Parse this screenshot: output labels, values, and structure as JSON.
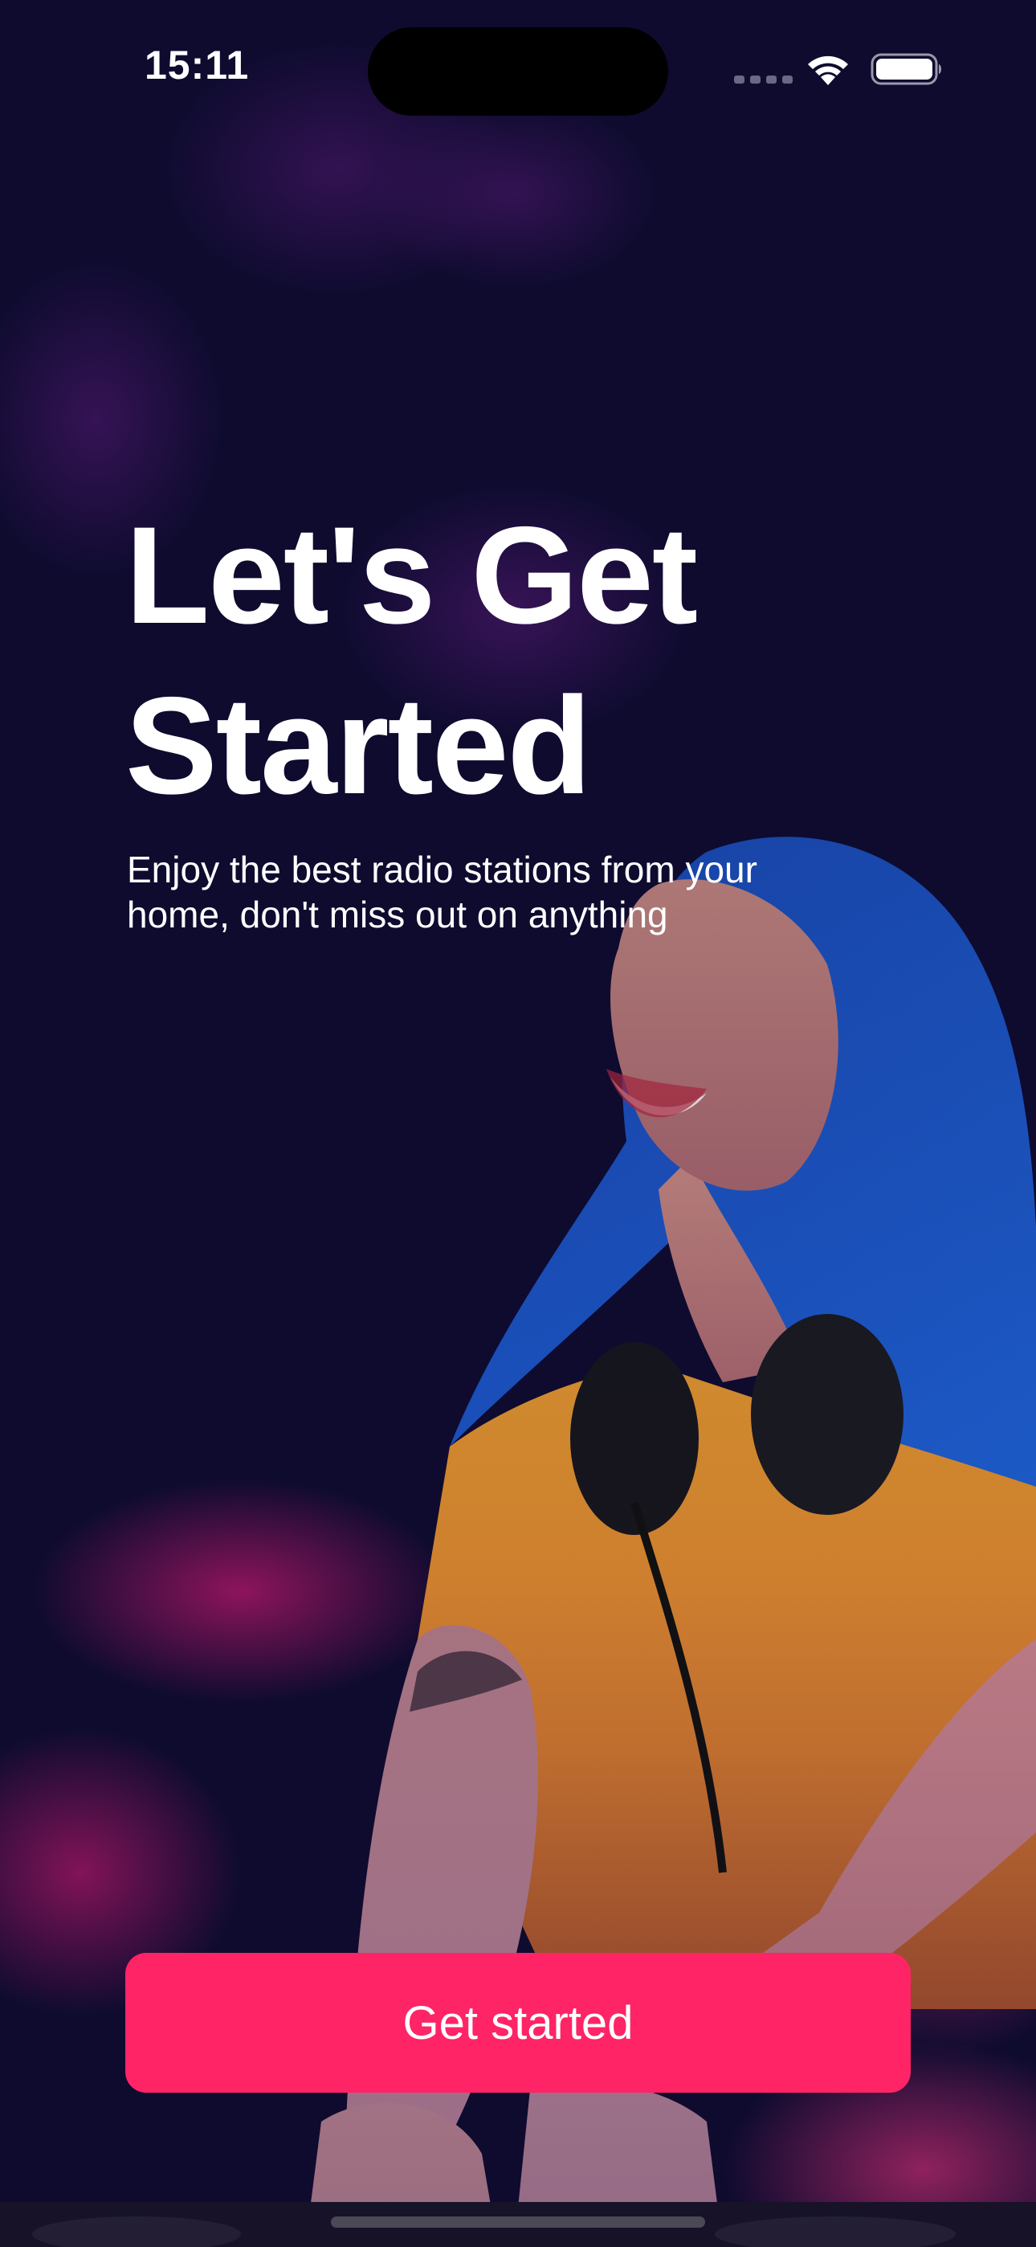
{
  "status_bar": {
    "time": "15:11"
  },
  "onboarding": {
    "title_line1": "Let's Get",
    "title_line2": "Started",
    "subtitle_line1": "Enjoy the best radio stations from your",
    "subtitle_line2": "home, don't miss out on anything",
    "cta_label": "Get started"
  },
  "icons": {
    "wifi": "wifi-icon",
    "battery": "battery-icon"
  },
  "colors": {
    "background": "#0e0b2f",
    "accent": "#fe2466",
    "text": "#ffffff"
  }
}
